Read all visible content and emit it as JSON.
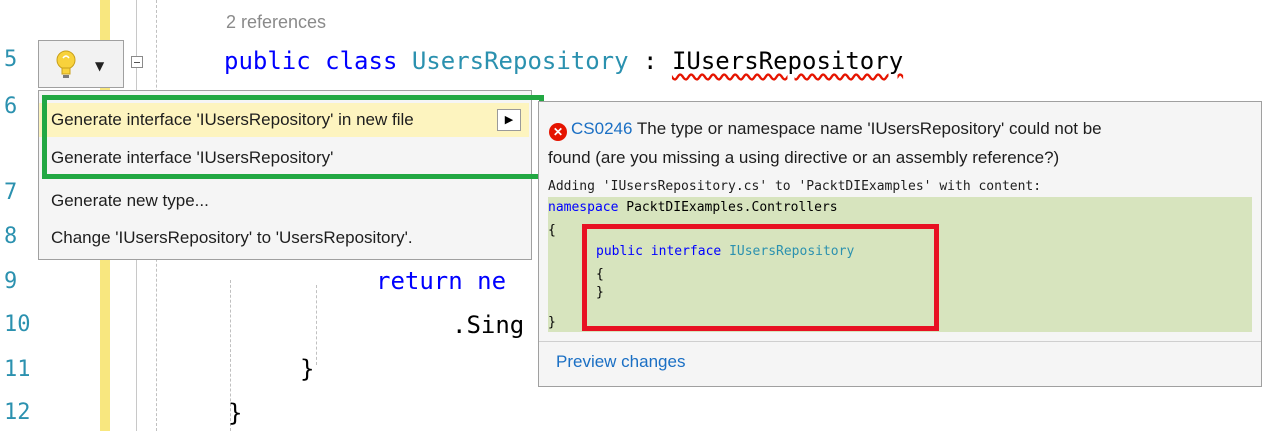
{
  "editor": {
    "codelens": "2 references",
    "lines": [
      {
        "num": "5",
        "kw1": "public class ",
        "type": "UsersRepository",
        "sep": " : ",
        "iface": "IUsersRepository"
      },
      {
        "num": "6"
      },
      {
        "num": "7"
      },
      {
        "num": "8"
      },
      {
        "num": "9",
        "kw": "return ne"
      },
      {
        "num": "10",
        "text": ".Sing"
      },
      {
        "num": "11",
        "text": "}"
      },
      {
        "num": "12",
        "text": "}"
      }
    ]
  },
  "quick_actions": {
    "items": [
      "Generate interface 'IUsersRepository' in new file",
      "Generate interface 'IUsersRepository'",
      "Generate new type...",
      "Change 'IUsersRepository' to 'UsersRepository'."
    ],
    "submenu_arrow": "▶"
  },
  "preview": {
    "error_code": "CS0246",
    "error_text_1": " The type or namespace name 'IUsersRepository' could not be",
    "error_text_2": "found (are you missing a using directive or an assembly reference?)",
    "adding_line": "Adding 'IUsersRepository.cs' to 'PacktDIExamples' with content:",
    "ns_keyword": "namespace",
    "ns_name": " PacktDIExamples.Controllers",
    "open_brace": "{",
    "iface_keyword": "public interface ",
    "iface_name": "IUsersRepository",
    "inner_open": "{",
    "inner_close": "}",
    "close_brace": "}",
    "link": "Preview changes"
  },
  "colors": {
    "highlight_green": "#22a843",
    "highlight_red": "#e81123",
    "error_red": "#e51400",
    "keyword_blue": "#0000ff",
    "type_teal": "#2b91af"
  },
  "icons": {
    "lightbulb": "lightbulb-icon",
    "dropdown": "chevron-down-icon",
    "error": "error-icon"
  }
}
